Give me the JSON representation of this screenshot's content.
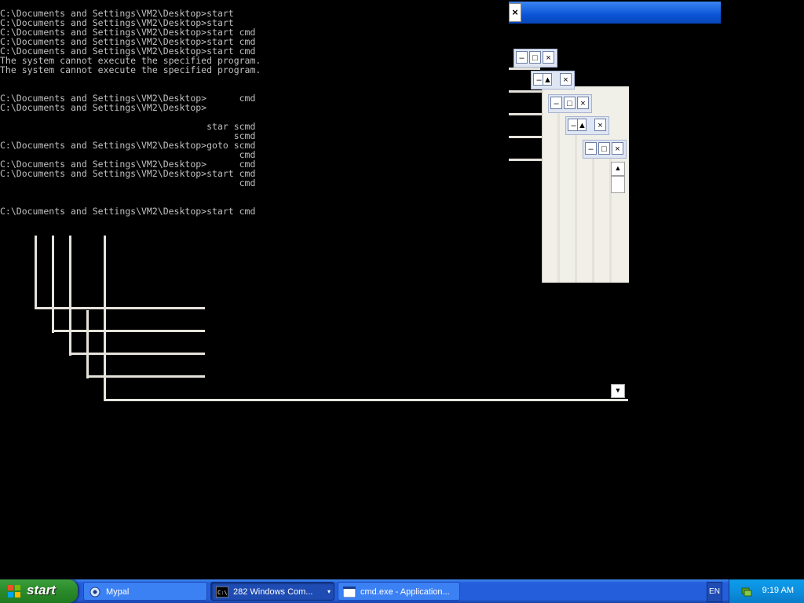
{
  "console": {
    "lines": [
      "C:\\Documents and Settings\\VM2\\Desktop>start",
      "C:\\Documents and Settings\\VM2\\Desktop>start",
      "C:\\Documents and Settings\\VM2\\Desktop>start cmd",
      "C:\\Documents and Settings\\VM2\\Desktop>start cmd",
      "C:\\Documents and Settings\\VM2\\Desktop>start cmd",
      "The system cannot execute the specified program.",
      "The system cannot execute the specified program.",
      "",
      "",
      "C:\\Documents and Settings\\VM2\\Desktop>      cmd",
      "C:\\Documents and Settings\\VM2\\Desktop>",
      "",
      "                                      star scmd",
      "                                           scmd",
      "C:\\Documents and Settings\\VM2\\Desktop>goto scmd",
      "                                            cmd",
      "C:\\Documents and Settings\\VM2\\Desktop>      cmd",
      "C:\\Documents and Settings\\VM2\\Desktop>start cmd",
      "                                            cmd",
      "",
      "",
      "C:\\Documents and Settings\\VM2\\Desktop>start cmd"
    ]
  },
  "icons": {
    "close": "×",
    "minimize": "–",
    "maximize": "□",
    "scroll_up": "▲",
    "scroll_down": "▼",
    "dropdown": "▾"
  },
  "taskbar": {
    "start_label": "start",
    "tasks": [
      {
        "label": "Mypal",
        "icon": "mypal-icon",
        "state": "normal"
      },
      {
        "label": "282 Windows Com...",
        "icon": "cmd-icon",
        "state": "active"
      },
      {
        "label": "cmd.exe - Application...",
        "icon": "window-icon",
        "state": "normal"
      }
    ],
    "language": "EN",
    "clock": "9:19 AM"
  },
  "colors": {
    "taskbar_blue": "#245edb",
    "start_green": "#2a8a2a",
    "tray_blue": "#0c8fde",
    "console_text": "#c0c0c0"
  }
}
